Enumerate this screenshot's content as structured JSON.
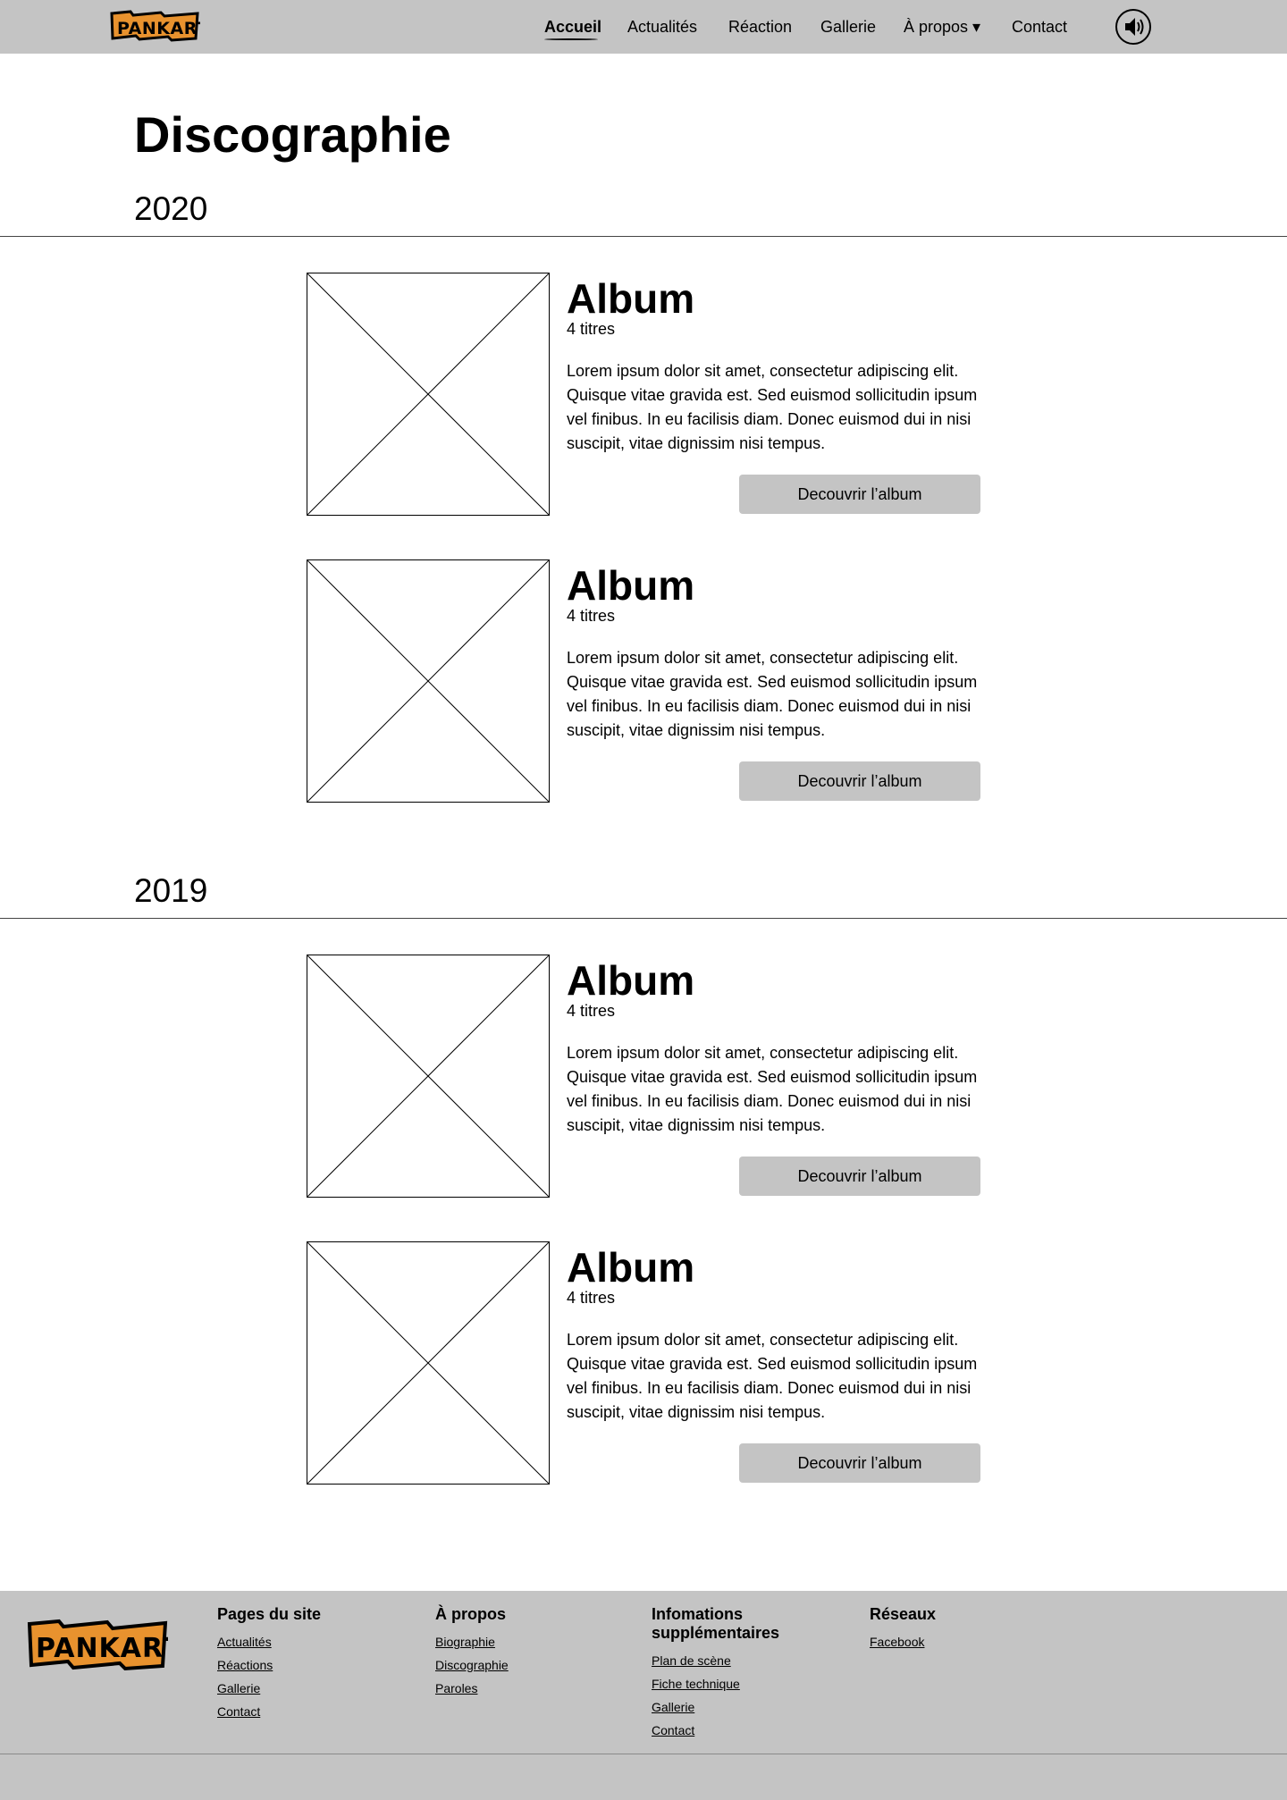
{
  "header": {
    "logo_text": "PANKART",
    "nav": [
      {
        "label": "Accueil",
        "active": true
      },
      {
        "label": "Actualités"
      },
      {
        "label": "Réaction"
      },
      {
        "label": "Gallerie"
      },
      {
        "label": "À propos ▾"
      },
      {
        "label": "Contact"
      }
    ],
    "sound_icon": "speaker-icon"
  },
  "main": {
    "title": "Discographie",
    "years": [
      {
        "year": "2020",
        "albums": [
          {
            "title": "Album",
            "count": "4 titres",
            "description": "Lorem ipsum dolor sit amet, consectetur adipiscing elit. Quisque vitae gravida est. Sed euismod sollicitudin ipsum vel finibus. In eu facilisis diam. Donec euismod dui in nisi suscipit, vitae dignissim nisi tempus.",
            "button": "Decouvrir l’album"
          },
          {
            "title": "Album",
            "count": "4 titres",
            "description": "Lorem ipsum dolor sit amet, consectetur adipiscing elit. Quisque vitae gravida est. Sed euismod sollicitudin ipsum vel finibus. In eu facilisis diam. Donec euismod dui in nisi suscipit, vitae dignissim nisi tempus.",
            "button": "Decouvrir l’album"
          }
        ]
      },
      {
        "year": "2019",
        "albums": [
          {
            "title": "Album",
            "count": "4 titres",
            "description": "Lorem ipsum dolor sit amet, consectetur adipiscing elit. Quisque vitae gravida est. Sed euismod sollicitudin ipsum vel finibus. In eu facilisis diam. Donec euismod dui in nisi suscipit, vitae dignissim nisi tempus.",
            "button": "Decouvrir l’album"
          },
          {
            "title": "Album",
            "count": "4 titres",
            "description": "Lorem ipsum dolor sit amet, consectetur adipiscing elit. Quisque vitae gravida est. Sed euismod sollicitudin ipsum vel finibus. In eu facilisis diam. Donec euismod dui in nisi suscipit, vitae dignissim nisi tempus.",
            "button": "Decouvrir l’album"
          }
        ]
      }
    ]
  },
  "footer": {
    "columns": [
      {
        "title": "Pages du site",
        "links": [
          "Actualités",
          "Réactions",
          "Gallerie",
          "Contact"
        ]
      },
      {
        "title": "À propos",
        "links": [
          "Biographie",
          "Discographie",
          "Paroles"
        ]
      },
      {
        "title": "Infomations supplémentaires",
        "links": [
          "Plan de scène",
          "Fiche technique",
          "Gallerie",
          "Contact"
        ]
      },
      {
        "title": "Réseaux",
        "links": [
          "Facebook"
        ]
      }
    ]
  },
  "colors": {
    "bar": "#c4c4c4",
    "logo_orange": "#e8922e",
    "button": "#c4c4c4"
  }
}
